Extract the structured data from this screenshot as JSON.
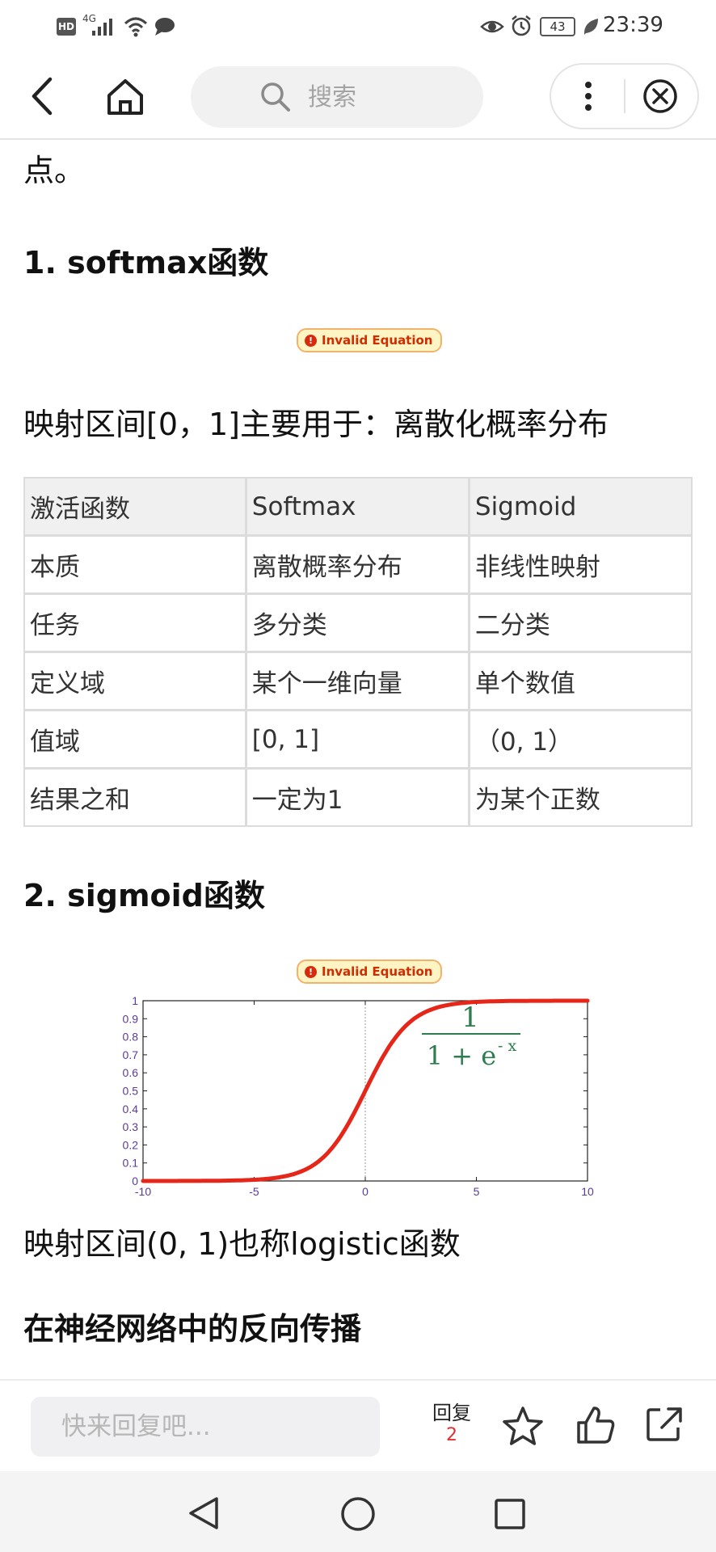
{
  "status_bar": {
    "hd": "HD",
    "network": "4G",
    "battery": "43",
    "time": "23:39"
  },
  "nav": {
    "search_placeholder": "搜索",
    "icons": [
      "back-icon",
      "home-icon",
      "search-icon",
      "more-icon",
      "close-icon"
    ]
  },
  "article": {
    "lead": "点。",
    "h_softmax": "1. softmax函数",
    "invalid_eq": "Invalid Equation",
    "softmax_note": "映射区间[0，1]主要用于：离散化概率分布",
    "table": {
      "header": [
        "激活函数",
        "Softmax",
        "Sigmoid"
      ],
      "rows": [
        [
          "本质",
          "离散概率分布",
          "非线性映射"
        ],
        [
          "任务",
          "多分类",
          "二分类"
        ],
        [
          "定义域",
          "某个一维向量",
          "单个数值"
        ],
        [
          "值域",
          "[0, 1]",
          "（0, 1）"
        ],
        [
          "结果之和",
          "一定为1",
          "为某个正数"
        ]
      ]
    },
    "h_sigmoid": "2. sigmoid函数",
    "sigmoid_note": "映射区间(0, 1)也称logistic函数",
    "h_backprop": "在神经网络中的反向传播"
  },
  "chart_data": {
    "type": "line",
    "xlim": [
      -10,
      10
    ],
    "ylim": [
      0,
      1
    ],
    "xticks": [
      "-10",
      "-5",
      "0",
      "5",
      "10"
    ],
    "yticks": [
      "0",
      "0.1",
      "0.2",
      "0.3",
      "0.4",
      "0.5",
      "0.6",
      "0.7",
      "0.8",
      "0.9",
      "1"
    ],
    "x_tick_values": [
      -10,
      -5,
      0,
      5,
      10
    ],
    "y_tick_values": [
      0,
      0.1,
      0.2,
      0.3,
      0.4,
      0.5,
      0.6,
      0.7,
      0.8,
      0.9,
      1
    ],
    "formula": {
      "numerator": "1",
      "denominator_base": "1 + e",
      "exponent": "- x"
    },
    "series": [
      {
        "function": "1/(1+e^(-x))",
        "color": "#e52618",
        "x": [
          -10,
          -8,
          -6,
          -5,
          -4,
          -3,
          -2,
          -1.5,
          -1,
          -0.5,
          0,
          0.5,
          1,
          1.5,
          2,
          3,
          4,
          5,
          6,
          8,
          10
        ],
        "y": [
          4.54e-05,
          0.000335,
          0.00247,
          0.00669,
          0.018,
          0.0474,
          0.119,
          0.182,
          0.269,
          0.378,
          0.5,
          0.622,
          0.731,
          0.818,
          0.881,
          0.953,
          0.982,
          0.993,
          0.9975,
          0.99966,
          0.99995
        ]
      }
    ],
    "colors": {
      "axis_ticks": "#5a3a9a",
      "curve": "#e52618",
      "formula": "#2e7d4f"
    },
    "grid": false
  },
  "reply_bar": {
    "placeholder": "快来回复吧...",
    "reply_label": "回复",
    "reply_count": "2",
    "icons": [
      "star-icon",
      "like-icon",
      "share-icon"
    ]
  },
  "system_nav": {
    "icons": [
      "sys-back-icon",
      "sys-home-icon",
      "sys-recents-icon"
    ]
  }
}
